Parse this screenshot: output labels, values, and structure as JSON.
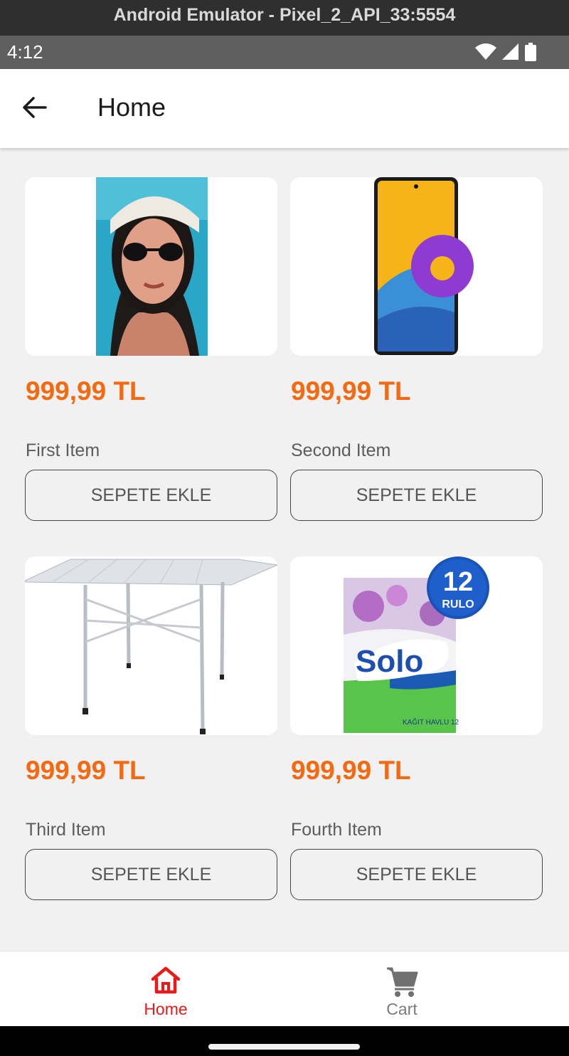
{
  "emulator": {
    "title": "Android Emulator - Pixel_2_API_33:5554"
  },
  "status_bar": {
    "time": "4:12",
    "icons": [
      "wifi-icon",
      "signal-icon",
      "battery-icon"
    ]
  },
  "app_bar": {
    "title": "Home",
    "back_icon": "arrow-back-icon"
  },
  "colors": {
    "price": "#f36a12",
    "nav_active": "#e81a1a",
    "nav_inactive": "#7a7a7a",
    "background": "#f1f1f1"
  },
  "products": [
    {
      "name": "First Item",
      "price": "999,99 TL",
      "button": "SEPETE EKLE",
      "image": "woman-sunglasses-photo"
    },
    {
      "name": "Second Item",
      "price": "999,99 TL",
      "button": "SEPETE EKLE",
      "image": "smartphone-photo"
    },
    {
      "name": "Third Item",
      "price": "999,99 TL",
      "button": "SEPETE EKLE",
      "image": "folding-table-photo"
    },
    {
      "name": "Fourth Item",
      "price": "999,99 TL",
      "button": "SEPETE EKLE",
      "image": "paper-towel-pack-photo",
      "image_text": {
        "badge_number": "12",
        "badge_word": "RULO",
        "brand": "Solo",
        "footer": "KAĞIT HAVLU 12"
      }
    }
  ],
  "bottom_nav": {
    "items": [
      {
        "label": "Home",
        "icon": "home-icon",
        "active": true
      },
      {
        "label": "Cart",
        "icon": "cart-icon",
        "active": false
      }
    ]
  }
}
